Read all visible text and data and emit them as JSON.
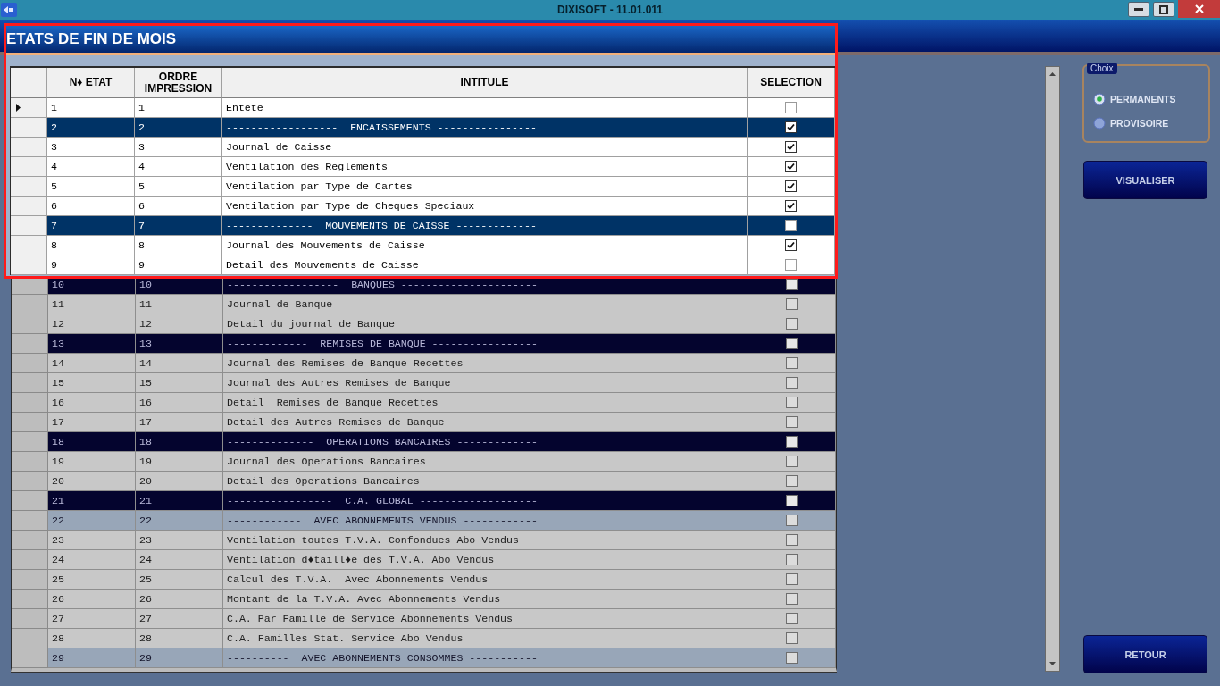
{
  "window": {
    "title": "DIXISOFT - 11.01.011"
  },
  "highlight": {
    "title": "ETATS DE FIN DE MOIS",
    "columns": [
      "N♦ ETAT",
      "ORDRE IMPRESSION",
      "INTITULE",
      "SELECTION"
    ],
    "rows": [
      {
        "kind": "item",
        "number": "1",
        "order": "1",
        "label": "Entete",
        "checked": false,
        "current": true
      },
      {
        "kind": "section",
        "number": "2",
        "order": "2",
        "label": "------------------  ENCAISSEMENTS ----------------",
        "checked": true,
        "current": false
      },
      {
        "kind": "item",
        "number": "3",
        "order": "3",
        "label": "Journal de Caisse",
        "checked": true,
        "current": false
      },
      {
        "kind": "item",
        "number": "4",
        "order": "4",
        "label": "Ventilation des Reglements",
        "checked": true,
        "current": false
      },
      {
        "kind": "item",
        "number": "5",
        "order": "5",
        "label": "Ventilation par Type de Cartes",
        "checked": true,
        "current": false
      },
      {
        "kind": "item",
        "number": "6",
        "order": "6",
        "label": "Ventilation par Type de Cheques Speciaux",
        "checked": true,
        "current": false
      },
      {
        "kind": "section",
        "number": "7",
        "order": "7",
        "label": "--------------  MOUVEMENTS DE CAISSE -------------",
        "checked": false,
        "current": false
      },
      {
        "kind": "item",
        "number": "8",
        "order": "8",
        "label": "Journal des Mouvements de Caisse",
        "checked": true,
        "current": false
      },
      {
        "kind": "item",
        "number": "9",
        "order": "9",
        "label": "Detail des Mouvements de Caisse",
        "checked": false,
        "current": false
      }
    ]
  },
  "blurred_rows": [
    {
      "kind": "section",
      "number": "10",
      "order": "10",
      "label": "------------------  BANQUES ----------------------",
      "checked": false,
      "current": false
    },
    {
      "kind": "item",
      "number": "11",
      "order": "11",
      "label": "Journal de Banque",
      "checked": false,
      "current": false
    },
    {
      "kind": "item",
      "number": "12",
      "order": "12",
      "label": "Detail du journal de Banque",
      "checked": false,
      "current": false
    },
    {
      "kind": "section",
      "number": "13",
      "order": "13",
      "label": "-------------  REMISES DE BANQUE -----------------",
      "checked": false,
      "current": false
    },
    {
      "kind": "item",
      "number": "14",
      "order": "14",
      "label": "Journal des Remises de Banque Recettes",
      "checked": false,
      "current": false
    },
    {
      "kind": "item",
      "number": "15",
      "order": "15",
      "label": "Journal des Autres Remises de Banque",
      "checked": false,
      "current": false
    },
    {
      "kind": "item",
      "number": "16",
      "order": "16",
      "label": "Detail  Remises de Banque Recettes",
      "checked": false,
      "current": false
    },
    {
      "kind": "item",
      "number": "17",
      "order": "17",
      "label": "Detail des Autres Remises de Banque",
      "checked": false,
      "current": false
    },
    {
      "kind": "section",
      "number": "18",
      "order": "18",
      "label": "--------------  OPERATIONS BANCAIRES -------------",
      "checked": false,
      "current": false
    },
    {
      "kind": "item",
      "number": "19",
      "order": "19",
      "label": "Journal des Operations Bancaires",
      "checked": false,
      "current": false
    },
    {
      "kind": "item",
      "number": "20",
      "order": "20",
      "label": "Detail des Operations Bancaires",
      "checked": false,
      "current": false
    },
    {
      "kind": "section",
      "number": "21",
      "order": "21",
      "label": "-----------------  C.A. GLOBAL -------------------",
      "checked": false,
      "current": false
    },
    {
      "kind": "subsection",
      "number": "22",
      "order": "22",
      "label": "------------  AVEC ABONNEMENTS VENDUS ------------",
      "checked": false,
      "current": false
    },
    {
      "kind": "item",
      "number": "23",
      "order": "23",
      "label": "Ventilation toutes T.V.A. Confondues Abo Vendus",
      "checked": false,
      "current": false
    },
    {
      "kind": "item",
      "number": "24",
      "order": "24",
      "label": "Ventilation d♦taill♦e des T.V.A. Abo Vendus",
      "checked": false,
      "current": false
    },
    {
      "kind": "item",
      "number": "25",
      "order": "25",
      "label": "Calcul des T.V.A.  Avec Abonnements Vendus",
      "checked": false,
      "current": false
    },
    {
      "kind": "item",
      "number": "26",
      "order": "26",
      "label": "Montant de la T.V.A. Avec Abonnements Vendus",
      "checked": false,
      "current": false
    },
    {
      "kind": "item",
      "number": "27",
      "order": "27",
      "label": "C.A. Par Famille de Service Abonnements Vendus",
      "checked": false,
      "current": false
    },
    {
      "kind": "item",
      "number": "28",
      "order": "28",
      "label": "C.A. Familles Stat. Service Abo Vendus",
      "checked": false,
      "current": false
    },
    {
      "kind": "subsection",
      "number": "29",
      "order": "29",
      "label": "----------  AVEC ABONNEMENTS CONSOMMES -----------",
      "checked": false,
      "current": false
    }
  ],
  "options": {
    "title": "Choix",
    "choices": [
      {
        "label": "PERMANENTS",
        "selected": true
      },
      {
        "label": "PROVISOIRE",
        "selected": false
      }
    ]
  },
  "buttons": [
    "VISUALISER",
    "RETOUR"
  ]
}
